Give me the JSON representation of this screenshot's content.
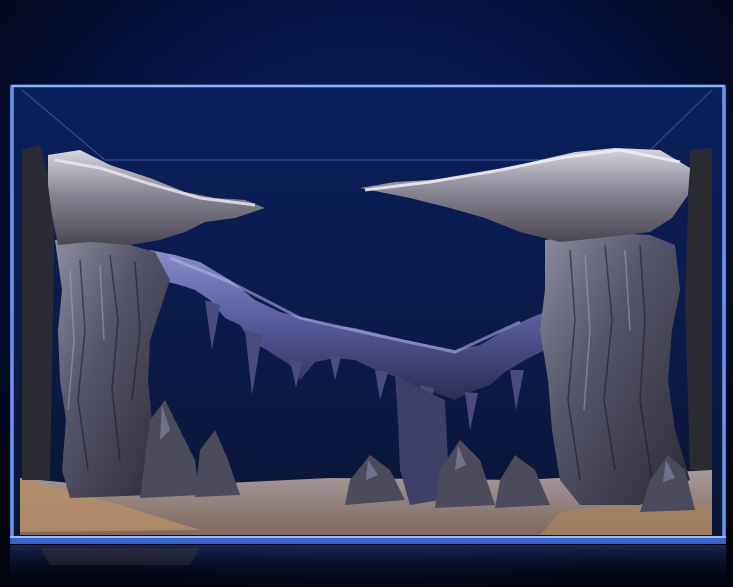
{
  "scene": {
    "subject": "aquarium-aquascape",
    "elements": [
      "glass-tank",
      "rock-arch",
      "left-rock-pillar",
      "right-rock-pillar",
      "sand-substrate",
      "reflection"
    ],
    "colors": {
      "background": "#050d2a",
      "tank_water": "#0a1a4d",
      "glass_edge": "#4f7fe0",
      "rock_dark": "#3a3a44",
      "rock_light": "#a9a9b8",
      "rock_blue": "#6a6fb0",
      "sand": "#b49a80"
    }
  }
}
